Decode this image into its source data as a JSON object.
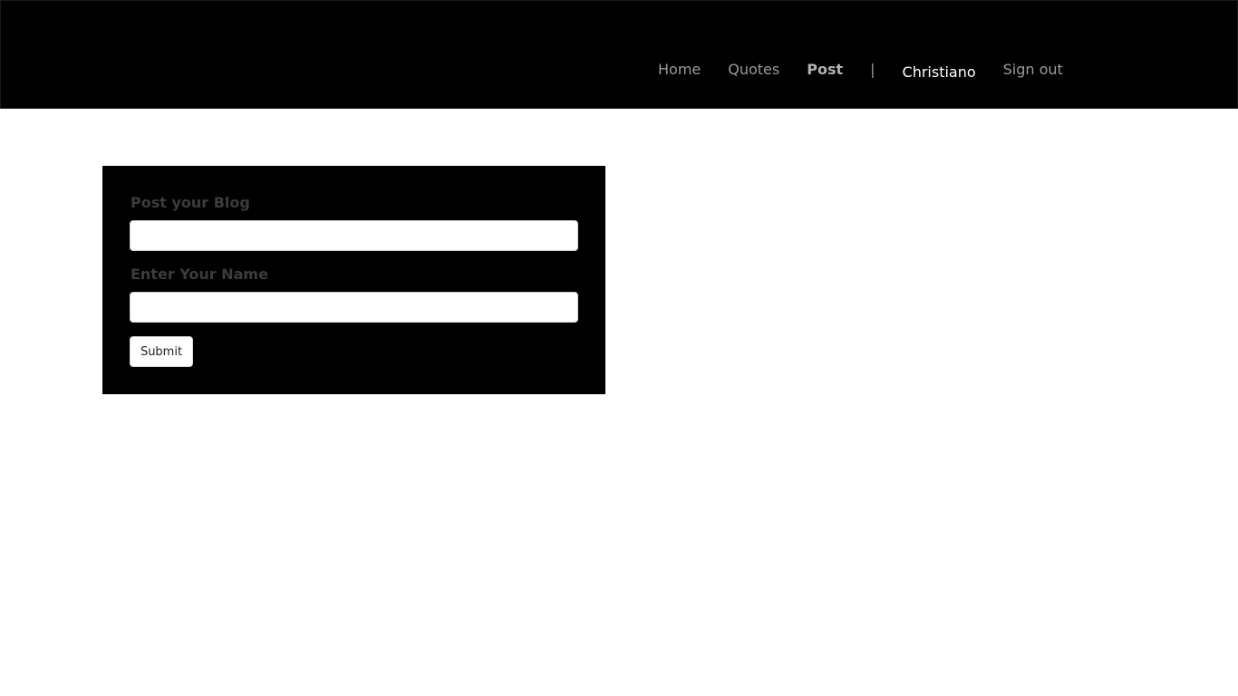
{
  "navbar": {
    "links": {
      "home": "Home",
      "quotes": "Quotes",
      "post": "Post",
      "separator": "|",
      "user": "Christiano",
      "signout": "Sign out"
    },
    "active_link": "Post"
  },
  "form": {
    "blog_label": "Post your Blog",
    "blog_value": "",
    "name_label": "Enter Your Name",
    "name_value": "",
    "submit_label": "Submit"
  },
  "colors": {
    "navbar_bg": "#000000",
    "panel_bg": "#000000",
    "nav_text": "#9a9a9a",
    "user_text": "#ffffff",
    "label_text": "#3c3c3c"
  }
}
